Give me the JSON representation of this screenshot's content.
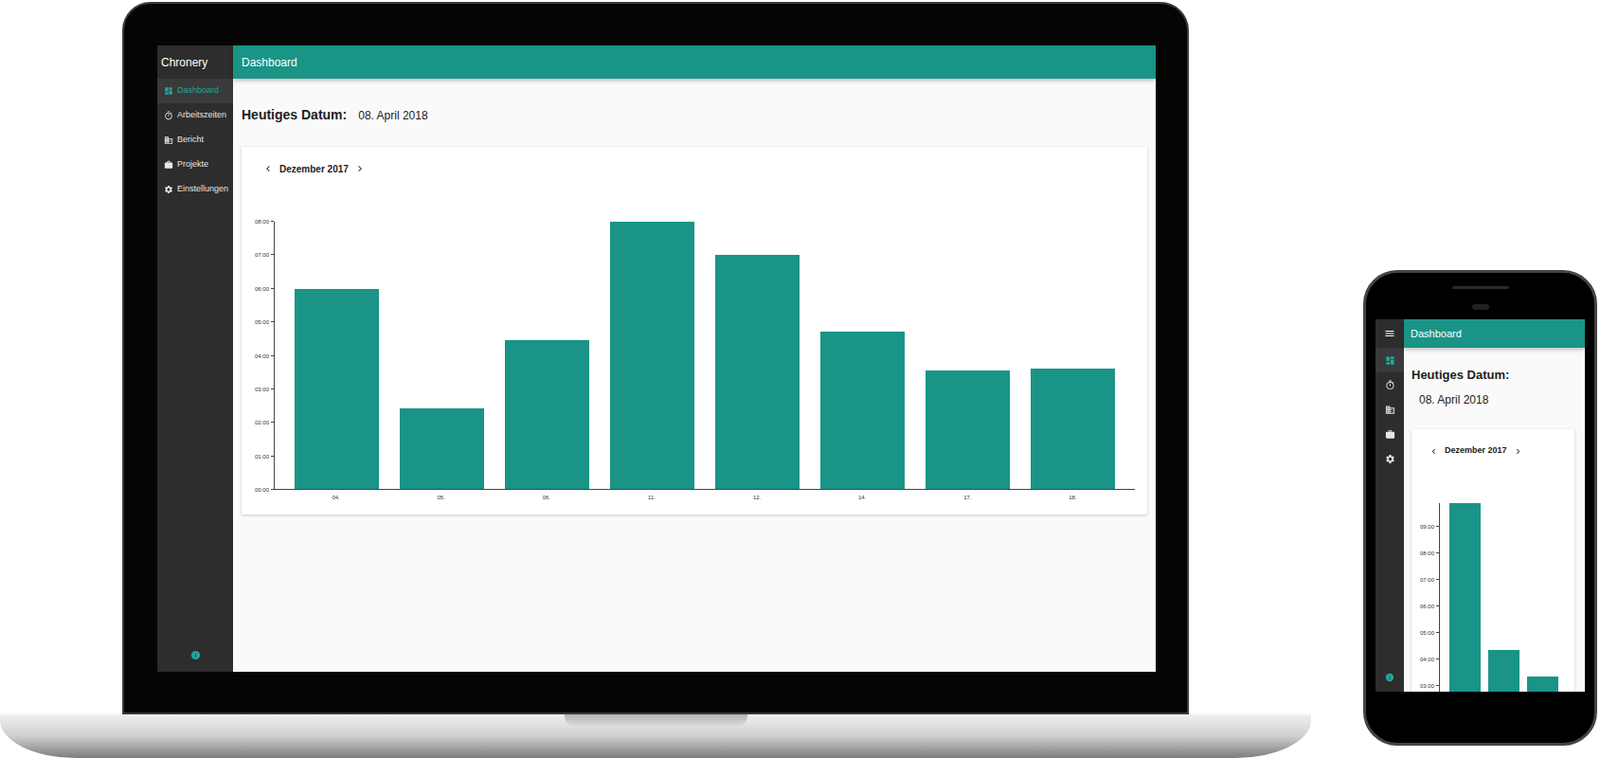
{
  "laptop": {
    "app_title": "Chronery",
    "header_title": "Dashboard",
    "sidebar": {
      "items": [
        {
          "label": "Dashboard",
          "selected": true
        },
        {
          "label": "Arbeitszeiten",
          "selected": false
        },
        {
          "label": "Bericht",
          "selected": false
        },
        {
          "label": "Projekte",
          "selected": false
        },
        {
          "label": "Einstellungen",
          "selected": false
        }
      ]
    },
    "date_label": "Heutiges Datum:",
    "date_value": "08. April 2018",
    "chart": {
      "month": "Dezember 2017",
      "y_ticks": [
        "00:00",
        "01:00",
        "02:00",
        "03:00",
        "04:00",
        "05:00",
        "06:00",
        "07:00",
        "08:00"
      ],
      "categories": [
        "04.",
        "05.",
        "06.",
        "11.",
        "12.",
        "14.",
        "17.",
        "18."
      ],
      "series": [
        {
          "values": [
            6.0,
            2.4,
            4.45,
            8.0,
            7.0,
            4.7,
            3.55,
            3.6
          ]
        }
      ]
    }
  },
  "phone": {
    "header_title": "Dashboard",
    "rail": {
      "items": [
        {
          "selected": true
        },
        {
          "selected": false
        },
        {
          "selected": false
        },
        {
          "selected": false
        },
        {
          "selected": false
        }
      ]
    },
    "date_label": "Heutiges Datum:",
    "date_value": "08. April 2018",
    "chart": {
      "month": "Dezember 2017",
      "y_ticks": [
        "03:00",
        "04:00",
        "05:00",
        "06:00",
        "07:00",
        "08:00",
        "09:00"
      ],
      "series": [
        {
          "values": [
            9.9,
            4.35,
            3.35
          ]
        }
      ]
    }
  }
}
